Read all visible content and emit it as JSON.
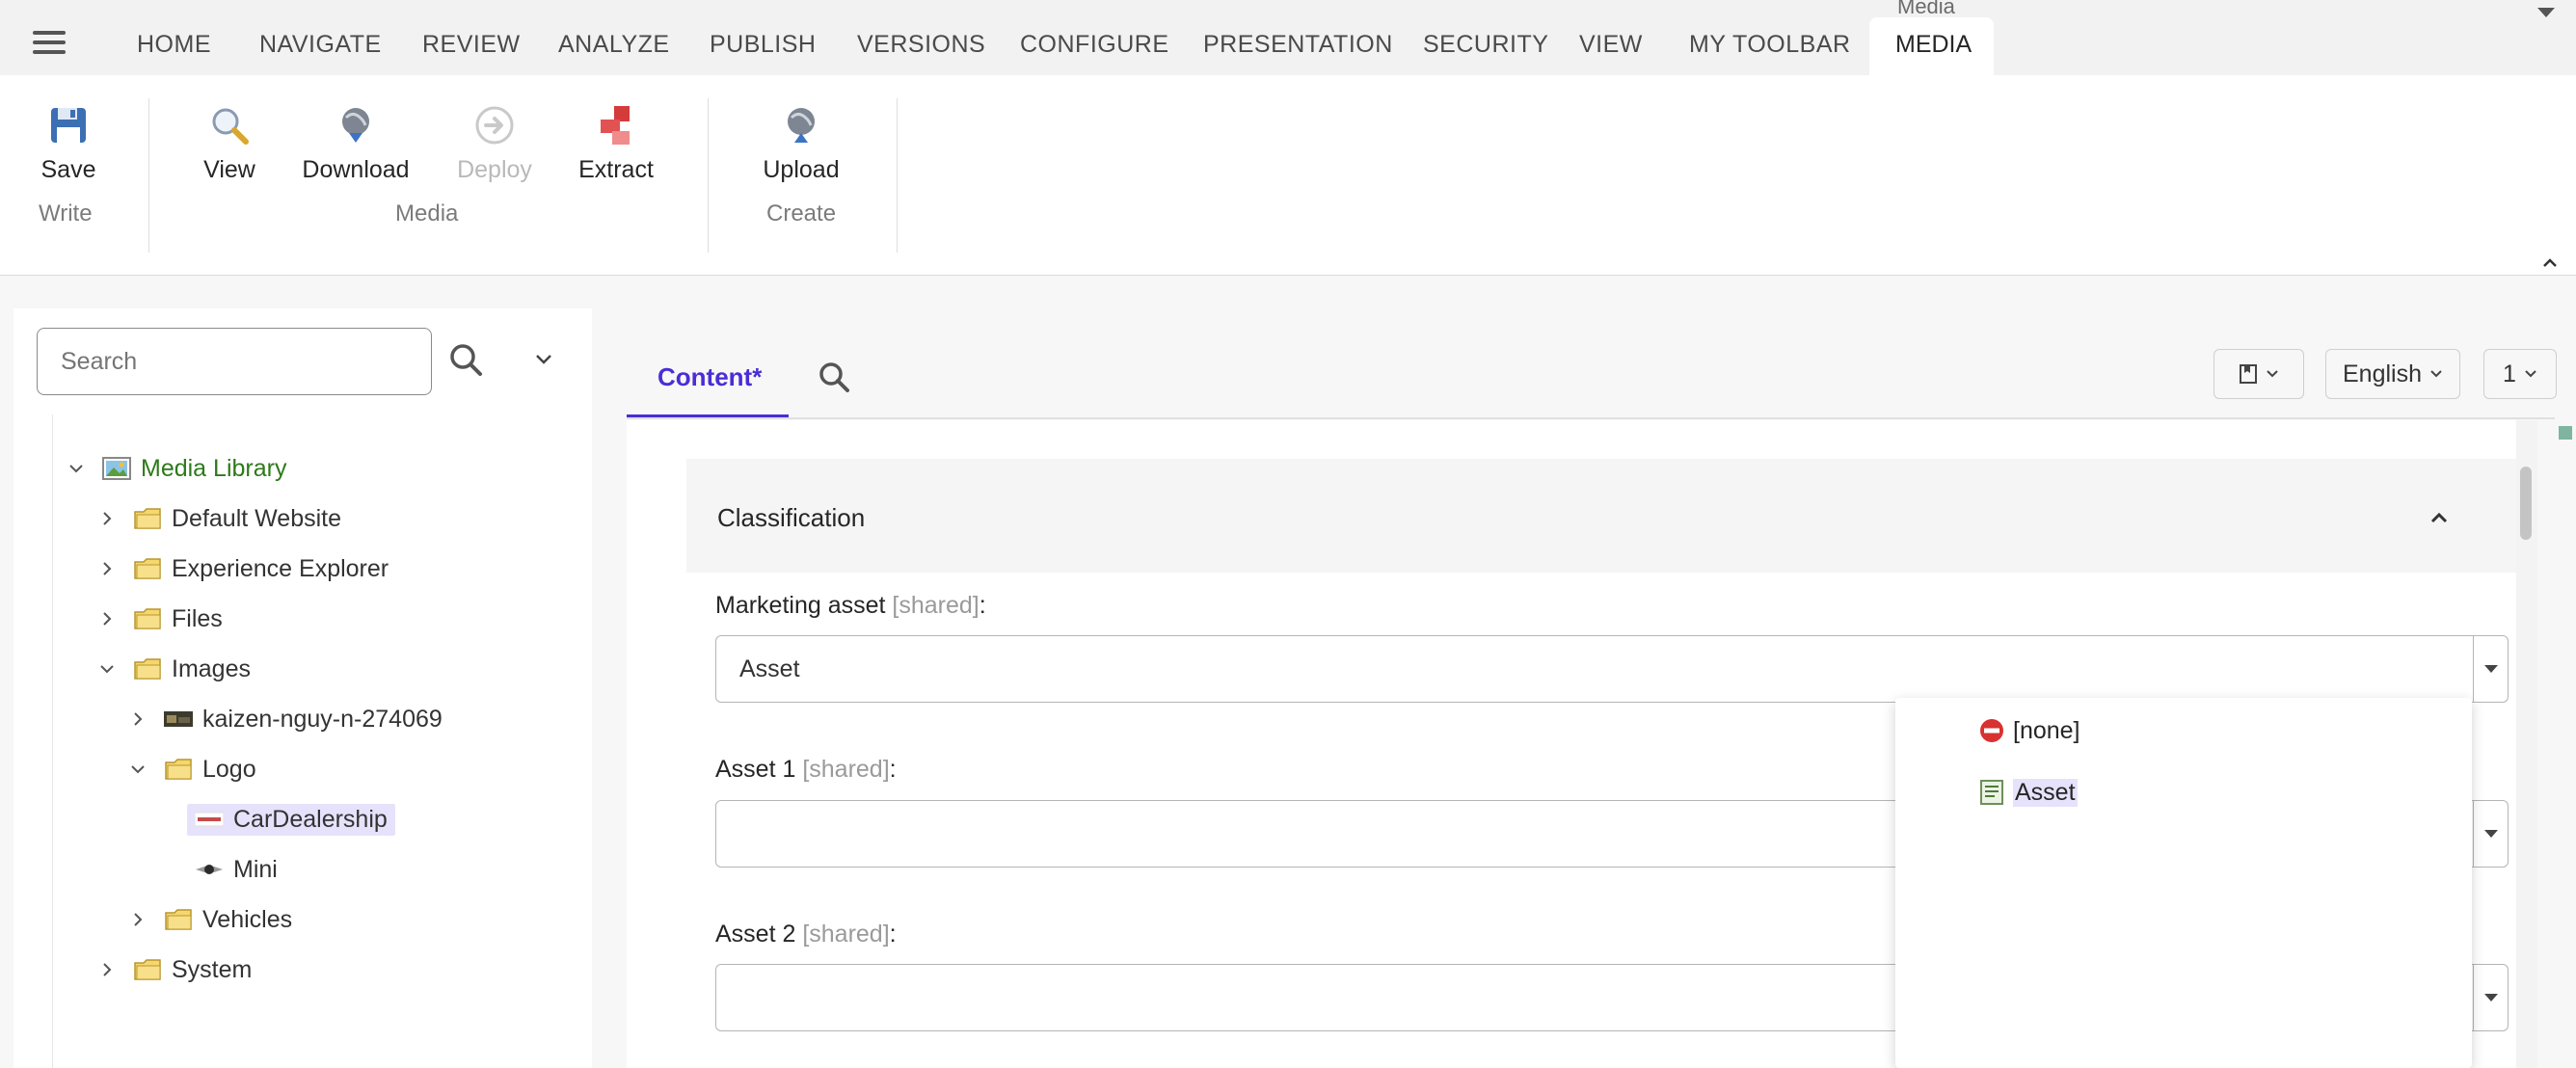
{
  "top_tabs": [
    "HOME",
    "NAVIGATE",
    "REVIEW",
    "ANALYZE",
    "PUBLISH",
    "VERSIONS",
    "CONFIGURE",
    "PRESENTATION",
    "SECURITY",
    "VIEW",
    "MY TOOLBAR"
  ],
  "active_tab": "MEDIA",
  "active_tab_caption": "Media",
  "ribbon": {
    "save": "Save",
    "write_group": "Write",
    "view": "View",
    "download": "Download",
    "deploy": "Deploy",
    "extract": "Extract",
    "media_group": "Media",
    "upload": "Upload",
    "create_group": "Create"
  },
  "tree": {
    "search_placeholder": "Search",
    "items": [
      {
        "label": "Media Library"
      },
      {
        "label": "Default Website"
      },
      {
        "label": "Experience Explorer"
      },
      {
        "label": "Files"
      },
      {
        "label": "Images"
      },
      {
        "label": "kaizen-nguy-n-274069"
      },
      {
        "label": "Logo"
      },
      {
        "label": "CarDealership"
      },
      {
        "label": "Mini"
      },
      {
        "label": "Vehicles"
      },
      {
        "label": "System"
      }
    ]
  },
  "content": {
    "tab_label": "Content*",
    "language": "English",
    "version": "1",
    "section_title": "Classification",
    "fields": [
      {
        "label": "Marketing asset",
        "shared": "[shared]",
        "colon": ":",
        "value": "Asset"
      },
      {
        "label": "Asset 1",
        "shared": "[shared]",
        "colon": ":",
        "value": ""
      },
      {
        "label": "Asset 2",
        "shared": "[shared]",
        "colon": ":",
        "value": ""
      }
    ]
  },
  "dropdown": {
    "options": [
      "[none]",
      "Asset"
    ],
    "highlighted": "Asset"
  },
  "colors": {
    "accent": "#4a2dd6",
    "selection": "#e6e2fb",
    "tree_root": "#2d7a1a"
  }
}
